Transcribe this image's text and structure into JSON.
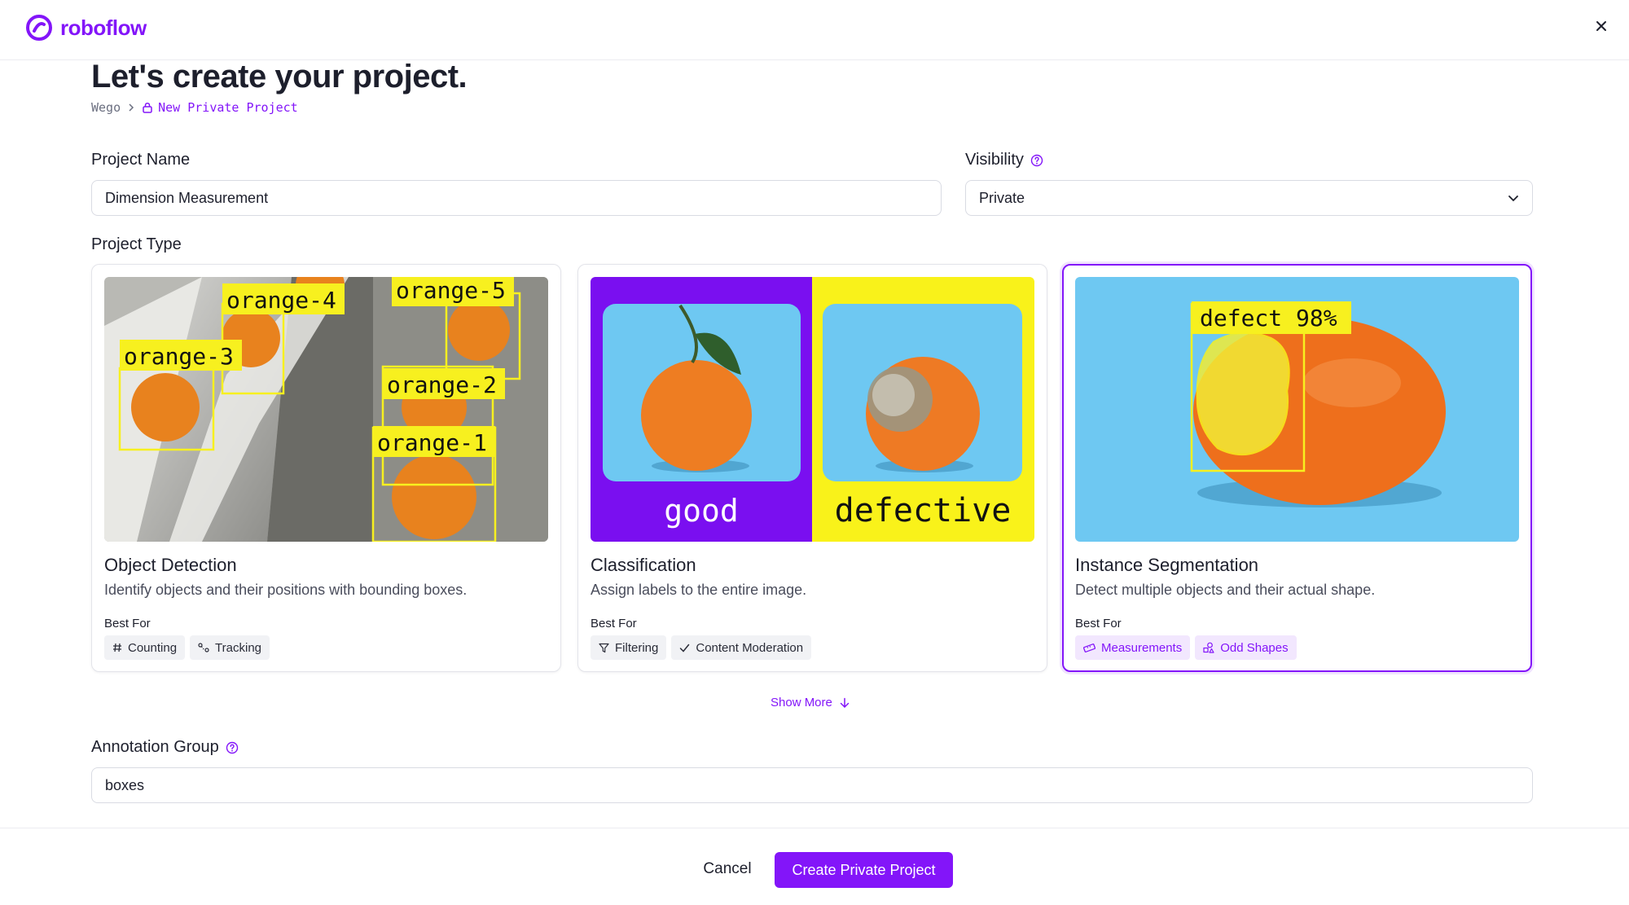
{
  "header": {
    "logo_text": "roboflow"
  },
  "page": {
    "title": "Let's create your project.",
    "breadcrumb_workspace": "Wego",
    "breadcrumb_current": "New Private Project"
  },
  "form": {
    "project_name_label": "Project Name",
    "project_name_value": "Dimension Measurement",
    "visibility_label": "Visibility",
    "visibility_value": "Private",
    "project_type_label": "Project Type",
    "annotation_group_label": "Annotation Group",
    "annotation_group_value": "boxes"
  },
  "project_types": [
    {
      "title": "Object Detection",
      "description": "Identify objects and their positions with bounding boxes.",
      "best_for_label": "Best For",
      "tags": [
        {
          "label": "Counting",
          "icon": "hash-icon"
        },
        {
          "label": "Tracking",
          "icon": "tracking-icon"
        }
      ],
      "image_labels": [
        "orange-4",
        "orange-5",
        "orange-3",
        "orange-2",
        "orange-1"
      ],
      "selected": false
    },
    {
      "title": "Classification",
      "description": "Assign labels to the entire image.",
      "best_for_label": "Best For",
      "tags": [
        {
          "label": "Filtering",
          "icon": "filter-icon"
        },
        {
          "label": "Content Moderation",
          "icon": "check-icon"
        }
      ],
      "image_labels": [
        "good",
        "defective"
      ],
      "selected": false
    },
    {
      "title": "Instance Segmentation",
      "description": "Detect multiple objects and their actual shape.",
      "best_for_label": "Best For",
      "tags": [
        {
          "label": "Measurements",
          "icon": "ruler-icon"
        },
        {
          "label": "Odd Shapes",
          "icon": "shapes-icon"
        }
      ],
      "image_labels": [
        "defect 98%"
      ],
      "selected": true
    }
  ],
  "show_more_label": "Show More",
  "footer": {
    "cancel_label": "Cancel",
    "create_label": "Create Private Project"
  },
  "colors": {
    "brand": "#8315f9",
    "detection_box": "#f7f01f",
    "classification_good_bg": "#7a0ff0",
    "classification_defective_bg": "#f9f21a",
    "sky_blue": "#6ec8f2"
  }
}
